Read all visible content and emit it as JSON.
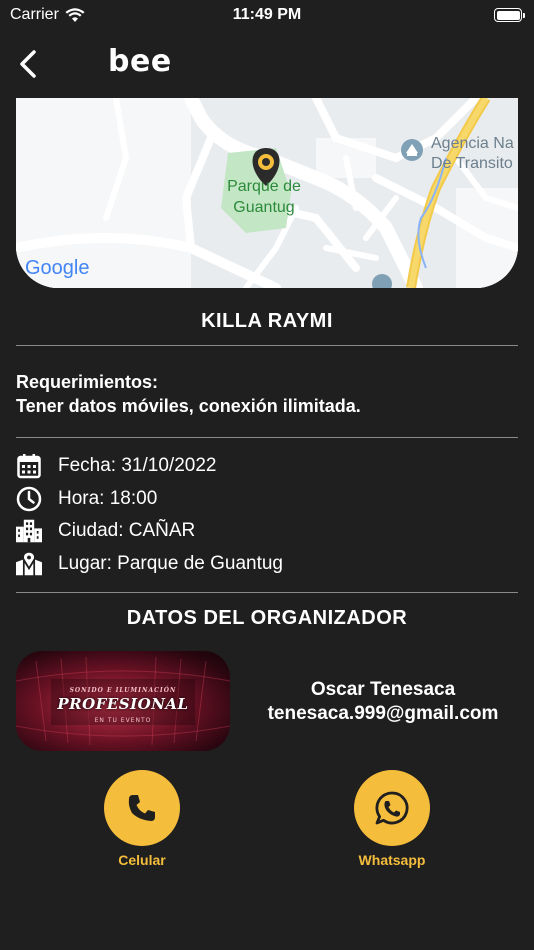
{
  "status_bar": {
    "carrier": "Carrier",
    "time": "11:49 PM"
  },
  "nav": {
    "logo": "bee"
  },
  "map": {
    "park_label_1": "Parque de",
    "park_label_2": "Guantug",
    "poi_label_1": "Agencia Na",
    "poi_label_2": "De Transito",
    "attribution": "Google"
  },
  "event": {
    "title": "KILLA RAYMI",
    "requirements_heading": "Requerimientos:",
    "requirements_text": "Tener datos móviles, conexión ilimitada."
  },
  "details": {
    "date": "Fecha: 31/10/2022",
    "time": "Hora:  18:00",
    "city": "Ciudad: CAÑAR",
    "place": "Lugar: Parque de Guantug"
  },
  "organizer": {
    "heading": "DATOS DEL ORGANIZADOR",
    "banner_top": "SONIDO E ILUMINACIÓN",
    "banner_main": "PROFESIONAL",
    "banner_sub": "EN TU EVENTO",
    "name": "Oscar Tenesaca",
    "email": "tenesaca.999@gmail.com"
  },
  "actions": {
    "phone_label": "Celular",
    "whatsapp_label": "Whatsapp"
  },
  "colors": {
    "background": "#1f1f1f",
    "accent": "#f5bd3c"
  }
}
